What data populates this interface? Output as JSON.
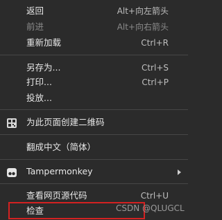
{
  "menu": {
    "back": {
      "label": "返回",
      "shortcut": "Alt+向左箭头"
    },
    "forward": {
      "label": "前进",
      "shortcut": "Alt+向右箭头"
    },
    "reload": {
      "label": "重新加载",
      "shortcut": "Ctrl+R"
    },
    "save_as": {
      "label": "另存为...",
      "shortcut": "Ctrl+S"
    },
    "print": {
      "label": "打印...",
      "shortcut": "Ctrl+P"
    },
    "cast": {
      "label": "投放..."
    },
    "qr_code": {
      "label": "为此页面创建二维码",
      "icon": "qr-code-icon"
    },
    "translate": {
      "label": "翻成中文（简体）"
    },
    "tampermonkey": {
      "label": "Tampermonkey",
      "icon": "tampermonkey-icon"
    },
    "view_source": {
      "label": "查看网页源代码",
      "shortcut": "Ctrl+U"
    },
    "inspect": {
      "label": "检查"
    }
  },
  "watermark": "CSDN @QLUGCL",
  "colors": {
    "background": "#2b2b2b",
    "highlight_border": "#d42121"
  }
}
